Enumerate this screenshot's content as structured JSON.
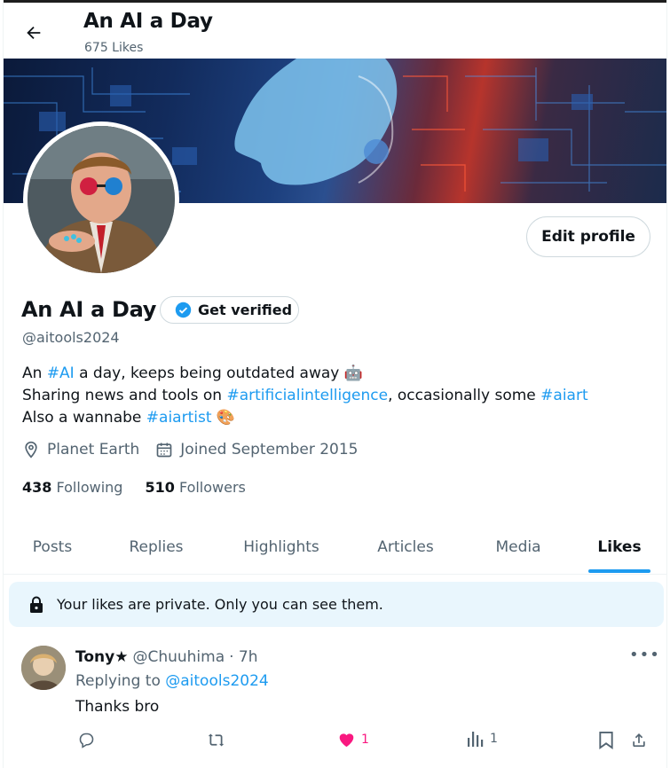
{
  "header": {
    "title": "An AI a Day",
    "subtitle": "675 Likes"
  },
  "profile": {
    "name": "An AI a Day",
    "verify_label": "Get verified",
    "handle": "@aitools2024",
    "edit_label": "Edit profile",
    "bio": {
      "line1_pre": "An ",
      "line1_tag": "#AI",
      "line1_post": " a day, keeps being outdated away",
      "line2_pre": "Sharing news and tools on ",
      "line2_tag1": "#artificialintelligence",
      "line2_mid": ", occasionally some ",
      "line2_tag2": "#aiart",
      "line3_pre": "Also a wannabe ",
      "line3_tag": "#aiartist"
    },
    "location": "Planet Earth",
    "joined": "Joined September 2015",
    "following_count": "438",
    "following_label": "Following",
    "followers_count": "510",
    "followers_label": "Followers"
  },
  "tabs": [
    "Posts",
    "Replies",
    "Highlights",
    "Articles",
    "Media",
    "Likes"
  ],
  "active_tab": "Likes",
  "notice": "Your likes are private. Only you can see them.",
  "tweet": {
    "name": "Tony★",
    "handle": "@Chuuhima",
    "time": "· 7h",
    "more": "•••",
    "replying_prefix": "Replying to ",
    "replying_handle": "@aitools2024",
    "text": "Thanks bro",
    "like_count": "1",
    "view_count": "1"
  },
  "colors": {
    "accent": "#1d9bf0",
    "like": "#f91880",
    "notice_bg": "#e9f6fd",
    "secondary_text": "#536471"
  },
  "icons": [
    "back-arrow-icon",
    "verified-badge-icon",
    "location-pin-icon",
    "calendar-icon",
    "lock-icon",
    "reply-icon",
    "retweet-icon",
    "heart-icon",
    "views-icon",
    "bookmark-icon",
    "share-icon",
    "more-icon",
    "robot-emoji-icon",
    "palette-emoji-icon"
  ]
}
